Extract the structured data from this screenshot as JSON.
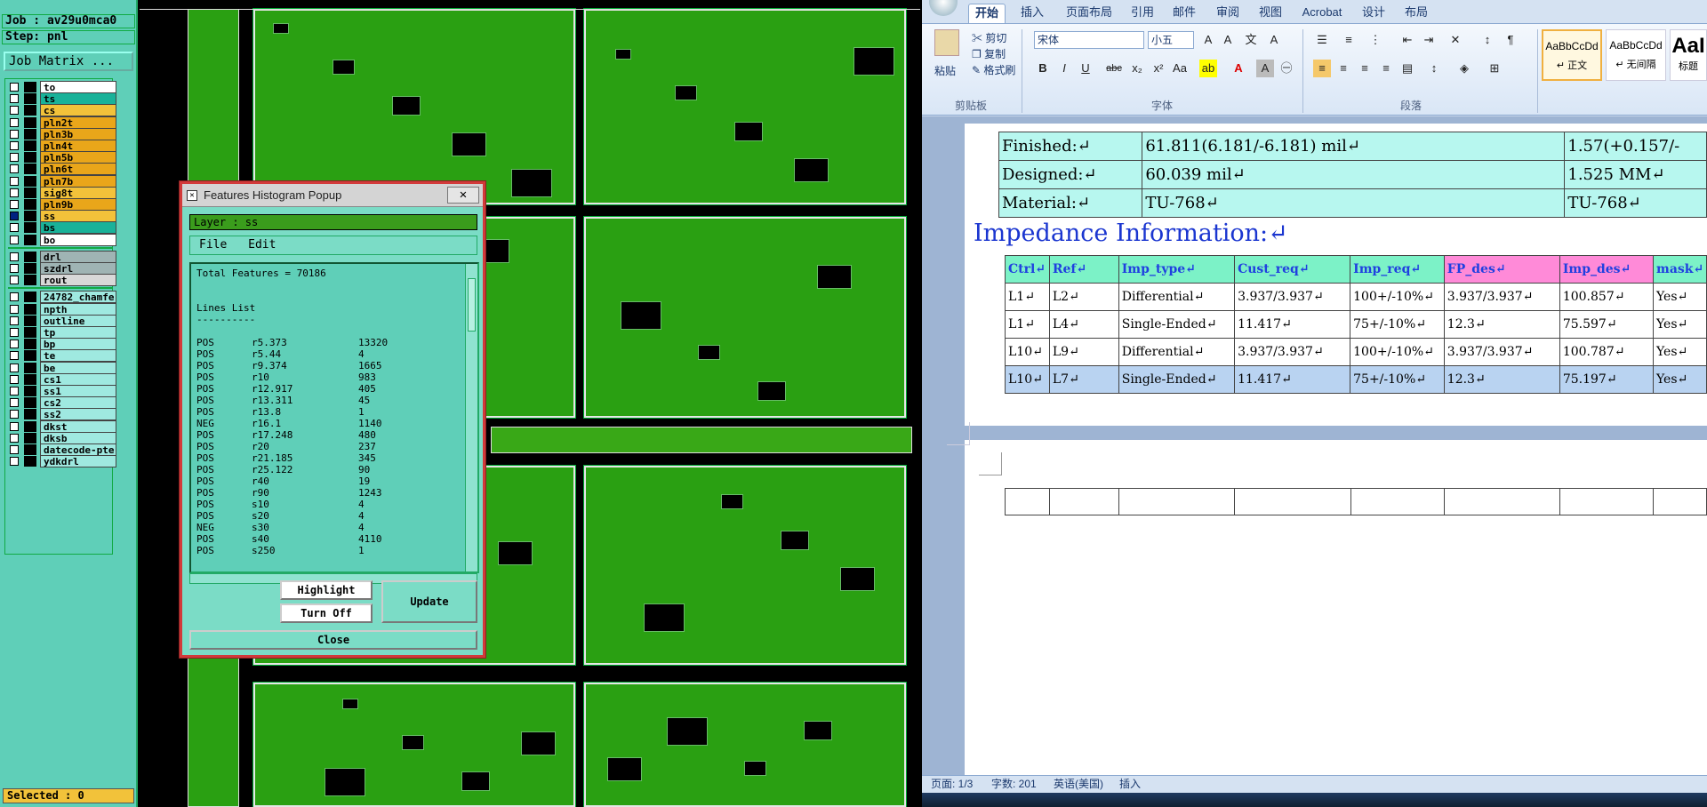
{
  "cam": {
    "job": "Job : av29u0mca0",
    "step": "Step: pnl",
    "matrix_button": "Job Matrix ...",
    "selected": "Selected : 0",
    "layers": [
      {
        "name": "to",
        "color": "#ffffff",
        "checked": false
      },
      {
        "name": "ts",
        "color": "#19b299",
        "checked": false
      },
      {
        "name": "cs",
        "color": "#f2c23a",
        "checked": false
      },
      {
        "name": "pln2t",
        "color": "#e9a61a",
        "checked": false
      },
      {
        "name": "pln3b",
        "color": "#e9a61a",
        "checked": false
      },
      {
        "name": "pln4t",
        "color": "#e9a61a",
        "checked": false
      },
      {
        "name": "pln5b",
        "color": "#e9a61a",
        "checked": false
      },
      {
        "name": "pln6t",
        "color": "#e9a61a",
        "checked": false
      },
      {
        "name": "pln7b",
        "color": "#e9a61a",
        "checked": false
      },
      {
        "name": "sig8t",
        "color": "#f2c23a",
        "checked": false
      },
      {
        "name": "pln9b",
        "color": "#e9a61a",
        "checked": false
      },
      {
        "name": "ss",
        "color": "#f2c23a",
        "checked": true
      },
      {
        "name": "bs",
        "color": "#19b299",
        "checked": false
      },
      {
        "name": "bo",
        "color": "#ffffff",
        "checked": false
      },
      {
        "name": "drl",
        "color": "#9fb4b4",
        "checked": false
      },
      {
        "name": "szdrl",
        "color": "#9fb4b4",
        "checked": false
      },
      {
        "name": "rout",
        "color": "#d8d8d8",
        "checked": false
      },
      {
        "name": "24782_chamfe",
        "color": "#9fe9e0",
        "checked": false
      },
      {
        "name": "npth",
        "color": "#9fe9e0",
        "checked": false
      },
      {
        "name": "outline",
        "color": "#9fe9e0",
        "checked": false
      },
      {
        "name": "tp",
        "color": "#9fe9e0",
        "checked": false
      },
      {
        "name": "bp",
        "color": "#9fe9e0",
        "checked": false
      },
      {
        "name": "te",
        "color": "#9fe9e0",
        "checked": false
      },
      {
        "name": "be",
        "color": "#9fe9e0",
        "checked": false
      },
      {
        "name": "cs1",
        "color": "#9fe9e0",
        "checked": false
      },
      {
        "name": "ss1",
        "color": "#9fe9e0",
        "checked": false
      },
      {
        "name": "cs2",
        "color": "#9fe9e0",
        "checked": false
      },
      {
        "name": "ss2",
        "color": "#9fe9e0",
        "checked": false
      },
      {
        "name": "dkst",
        "color": "#9fe9e0",
        "checked": false
      },
      {
        "name": "dksb",
        "color": "#9fe9e0",
        "checked": false
      },
      {
        "name": "datecode-pte",
        "color": "#9fe9e0",
        "checked": false
      },
      {
        "name": "ydkdrl",
        "color": "#9fe9e0",
        "checked": false
      }
    ]
  },
  "popup": {
    "title": "Features Histogram Popup",
    "close_glyph": "✕",
    "layer_label": "Layer :  ss",
    "menu_file": "File",
    "menu_edit": "Edit",
    "total": "Total Features = 70186",
    "list_title": "Lines List",
    "list_underline": "----------",
    "rows": [
      [
        "POS",
        "r5.373",
        "13320"
      ],
      [
        "POS",
        "r5.44",
        "4"
      ],
      [
        "POS",
        "r9.374",
        "1665"
      ],
      [
        "POS",
        "r10",
        "983"
      ],
      [
        "POS",
        "r12.917",
        "405"
      ],
      [
        "POS",
        "r13.311",
        "45"
      ],
      [
        "POS",
        "r13.8",
        "1"
      ],
      [
        "NEG",
        "r16.1",
        "1140"
      ],
      [
        "POS",
        "r17.248",
        "480"
      ],
      [
        "POS",
        "r20",
        "237"
      ],
      [
        "POS",
        "r21.185",
        "345"
      ],
      [
        "POS",
        "r25.122",
        "90"
      ],
      [
        "POS",
        "r40",
        "19"
      ],
      [
        "POS",
        "r90",
        "1243"
      ],
      [
        "POS",
        "s10",
        "4"
      ],
      [
        "POS",
        "s20",
        "4"
      ],
      [
        "NEG",
        "s30",
        "4"
      ],
      [
        "POS",
        "s40",
        "4110"
      ],
      [
        "POS",
        "s250",
        "1"
      ]
    ],
    "highlight_label": "Highlight",
    "turnoff_label": "Turn Off",
    "update_label": "Update",
    "close_label": "Close"
  },
  "word": {
    "tabs": [
      "开始",
      "插入",
      "页面布局",
      "引用",
      "邮件",
      "审阅",
      "视图",
      "Acrobat",
      "设计",
      "布局"
    ],
    "active_tab": "开始",
    "clipboard": {
      "paste": "粘贴",
      "cut": "剪切",
      "copy": "复制",
      "format_painter": "格式刷",
      "label": "剪贴板"
    },
    "font": {
      "name": "宋体",
      "size": "小五",
      "label": "字体"
    },
    "paragraph_label": "段落",
    "styles": [
      {
        "preview": "AaBbCcDd",
        "name": "↵ 正文"
      },
      {
        "preview": "AaBbCcDd",
        "name": "↵ 无间隔"
      },
      {
        "preview": "AaI",
        "name": "标题"
      }
    ],
    "material_table": [
      [
        "Finished:↵",
        "61.811(6.181/-6.181) mil↵",
        "1.57(+0.157/-"
      ],
      [
        "Designed:↵",
        "60.039 mil↵",
        "1.525 MM↵"
      ],
      [
        "Material:↵",
        "TU-768↵",
        "TU-768↵"
      ]
    ],
    "impedance_title": "Impedance Information:↵",
    "impedance_header": [
      "Ctrl↵",
      "Ref↵",
      "Imp_type↵",
      "Cust_req↵",
      "Imp_req↵",
      "FP_des↵",
      "Imp_des↵",
      "mask↵"
    ],
    "impedance_rows": [
      [
        "L1↵",
        "L2↵",
        "Differential↵",
        "3.937/3.937↵",
        "100+/-10%↵",
        "3.937/3.937↵",
        "100.857↵",
        "Yes↵"
      ],
      [
        "L1↵",
        "L4↵",
        "Single-Ended↵",
        "11.417↵",
        "75+/-10%↵",
        "12.3↵",
        "75.597↵",
        "Yes↵"
      ],
      [
        "L10↵",
        "L9↵",
        "Differential↵",
        "3.937/3.937↵",
        "100+/-10%↵",
        "3.937/3.937↵",
        "100.787↵",
        "Yes↵"
      ],
      [
        "L10↵",
        "L7↵",
        "Single-Ended↵",
        "11.417↵",
        "75+/-10%↵",
        "12.3↵",
        "75.197↵",
        "Yes↵"
      ]
    ],
    "status": {
      "page": "页面: 1/3",
      "words": "字数: 201",
      "lang": "英语(美国)",
      "mode": "插入"
    }
  }
}
